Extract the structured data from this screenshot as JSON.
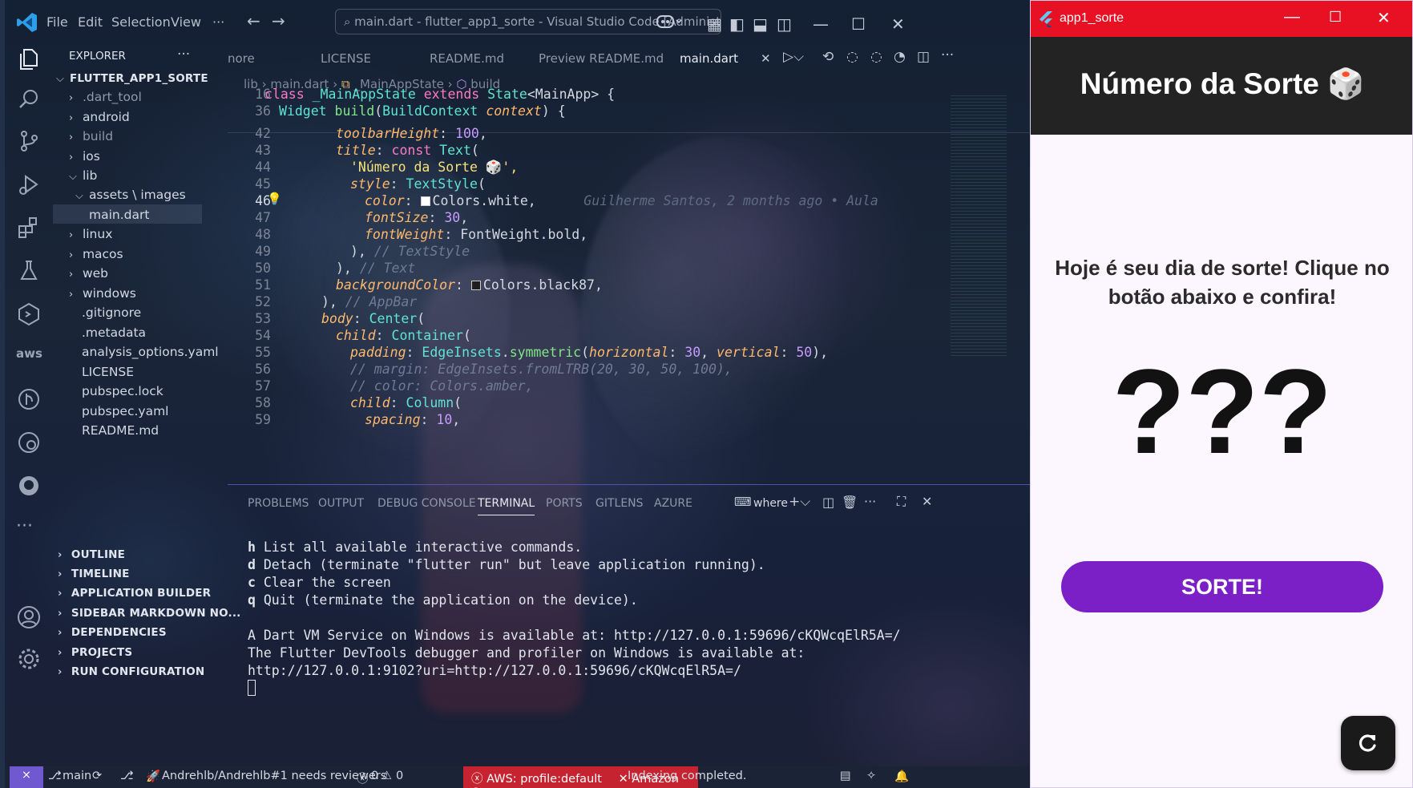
{
  "vscode": {
    "menu": [
      "File",
      "Edit",
      "Selection",
      "View",
      "···"
    ],
    "command_center": "main.dart - flutter_app1_sorte - Visual Studio Code [Administrator]",
    "explorer": {
      "header": "EXPLORER",
      "more": "···",
      "project": "FLUTTER_APP1_SORTE",
      "items": [
        ".dart_tool",
        "android",
        "build",
        "ios",
        "lib",
        "assets \\ images",
        "main.dart",
        "linux",
        "macos",
        "web",
        "windows",
        ".gitignore",
        ".metadata",
        "analysis_options.yaml",
        "LICENSE",
        "pubspec.lock",
        "pubspec.yaml",
        "README.md"
      ],
      "sections": [
        "OUTLINE",
        "TIMELINE",
        "APPLICATION BUILDER",
        "SIDEBAR MARKDOWN NO...",
        "DEPENDENCIES",
        "PROJECTS",
        "RUN CONFIGURATION"
      ]
    },
    "tabs": [
      "nore",
      "LICENSE",
      "README.md",
      "Preview README.md",
      "main.dart"
    ],
    "active_tab": "main.dart",
    "breadcrumbs": {
      "a": "lib",
      "b": "main.dart",
      "c": "_MainAppState",
      "d": "build"
    },
    "line_numbers": [
      "16",
      "36",
      "42",
      "43",
      "44",
      "45",
      "46",
      "47",
      "48",
      "49",
      "50",
      "51",
      "52",
      "53",
      "54",
      "55",
      "56",
      "57",
      "58",
      "59"
    ],
    "code": {
      "l16": {
        "kw": "class",
        "name": "_MainAppState",
        "kw2": "extends",
        "ty": "State",
        "gen": "<MainApp> {"
      },
      "l36": {
        "ty": "Widget",
        "fn": "build",
        "ty2": "BuildContext",
        "var": "context",
        "end": ") {"
      },
      "l42": {
        "prop": "toolbarHeight",
        "num": "100"
      },
      "l43": {
        "prop": "title",
        "kw": "const",
        "ty": "Text"
      },
      "l44": {
        "str": "'Número da Sorte 🎲',"
      },
      "l45": {
        "prop": "style",
        "ty": "TextStyle"
      },
      "l46": {
        "prop": "color",
        "val": "Colors.white,",
        "blame": "Guilherme Santos, 2 months ago • Aula"
      },
      "l47": {
        "prop": "fontSize",
        "num": "30"
      },
      "l48": {
        "prop": "fontWeight",
        "val": "FontWeight.bold,"
      },
      "l49": {
        "cmt": "// TextStyle"
      },
      "l50": {
        "cmt": "// Text"
      },
      "l51": {
        "prop": "backgroundColor",
        "val": "Colors.black87,"
      },
      "l52": {
        "cmt": "// AppBar"
      },
      "l53": {
        "prop": "body",
        "ty": "Center"
      },
      "l54": {
        "prop": "child",
        "ty": "Container"
      },
      "l55": {
        "prop": "padding",
        "ty": "EdgeInsets",
        "fn": "symmetric",
        "a1": "horizontal",
        "n1": "30",
        "a2": "vertical",
        "n2": "50"
      },
      "l56": {
        "cmt": "// margin: EdgeInsets.fromLTRB(20, 30, 50, 100),"
      },
      "l57": {
        "cmt": "// color: Colors.amber,"
      },
      "l58": {
        "prop": "child",
        "ty": "Column"
      },
      "l59": {
        "prop": "spacing",
        "num": "10"
      }
    },
    "panel_tabs": [
      "PROBLEMS",
      "OUTPUT",
      "DEBUG CONSOLE",
      "TERMINAL",
      "PORTS",
      "GITLENS",
      "AZURE"
    ],
    "terminal_name": "where",
    "terminal": {
      "l1k": "h",
      "l1": " List all available interactive commands.",
      "l2k": "d",
      "l2": " Detach (terminate \"flutter run\" but leave application running).",
      "l3k": "c",
      "l3": " Clear the screen",
      "l4k": "q",
      "l4": " Quit (terminate the application on the device).",
      "l5": "A Dart VM Service on Windows is available at: http://127.0.0.1:59696/cKQWcqElR5A=/",
      "l6": "The Flutter DevTools debugger and profiler on Windows is available at:",
      "l7": "http://127.0.0.1:9102?uri=http://127.0.0.1:59696/cKQWcqElR5A=/"
    },
    "status": {
      "branch": "main",
      "pr": "Andrehlb/Andrehlb#1 needs reviewers",
      "errors": "0",
      "warnings": "0",
      "aws": "AWS: profile:default",
      "amazonq": "Amazon Q",
      "indexing": "Indexing completed."
    }
  },
  "app": {
    "window_title": "app1_sorte",
    "title": "Número da Sorte 🎲",
    "message": "Hoje é seu dia de sorte! Clique no botão abaixo e confira!",
    "number": "???",
    "button": "SORTE!",
    "colors": {
      "appbar": "#232323",
      "button": "#7b1fc6",
      "titlebar": "#e81123"
    }
  }
}
